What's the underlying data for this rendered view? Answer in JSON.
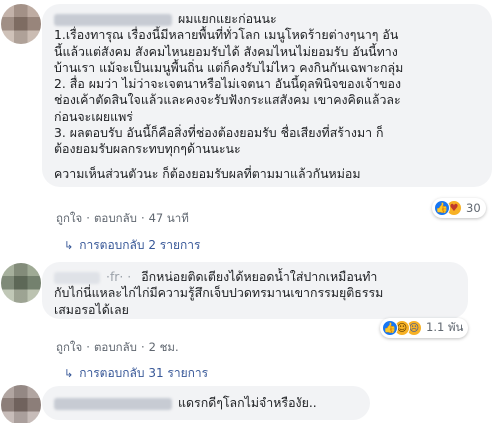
{
  "comments": [
    {
      "text_lines": [
        "ผมแยกแยะก่อนนะ",
        "1.เรื่องทารุณ เรื่องนี้มีหลายพื้นที่ทั่วโลก เมนูโหดร้ายต่างๆนาๆ อัน",
        "นี้แล้วแต่สังคม สังคมไหนยอมรับได้ สังคมไหนไม่ยอมรับ อันนี้ทาง",
        "บ้านเรา แม้จะเป็นเมนูพื้นถิ่น แต่ก็คงรับไม่ไหว คงกินกันเฉพาะกลุ่ม",
        "2. สื่อ ผมว่า ไม่ว่าจะเจตนาหรือไม่เจตนา อันนี้ดุลพินิจของเจ้าของ",
        "ช่องเค้าตัดสินใจแล้วและคงจะรับฟังกระแสสังคม เขาคงคิดแล้วละ",
        "ก่อนจะเผยแพร่",
        "3. ผลตอบรับ อันนี้ก็คือสิ่งที่ช่องต้องยอมรับ ชื่อเสียงที่สร้างมา ก็",
        "ต้องยอมรับผลกระทบทุกๆด้านนะนะ"
      ],
      "closing_line": "ความเห็นส่วนตัวนะ ก็ต้องยอมรับผลที่ตามมาแล้วกันหม่อม",
      "like_label": "ถูกใจ",
      "reply_label": "ตอบกลับ",
      "time": "47 นาที",
      "reaction_count": "30",
      "reactions": [
        "like-icon",
        "care-icon"
      ],
      "replies_label": "การตอบกลับ 2 รายการ"
    },
    {
      "name_partial": "·fr· ·",
      "text_lines": [
        "อีกหน่อยติดเตียงได้หยอดน้ำใส่ปากเหมือนทำ",
        "กับไก่นี่แหละไก่ไก่มีความรู้สึกเจ็บปวดทรมานเขากรรมยุติธรรม",
        "เสมอรอได้เลย"
      ],
      "like_label": "ถูกใจ",
      "reply_label": "ตอบกลับ",
      "time": "2 ชม.",
      "reaction_count": "1.1 พัน",
      "reactions": [
        "like-icon",
        "haha-icon",
        "sad-icon"
      ],
      "replies_label": "การตอบกลับ 31 รายการ"
    },
    {
      "text_lines": [
        "แดรกดีๆโลกไม่จำหรืองัย.."
      ]
    }
  ],
  "colors": {
    "bubble_bg": "#f2f3f5",
    "link": "#385898",
    "meta": "#606770",
    "like_blue": "#1877f2"
  }
}
